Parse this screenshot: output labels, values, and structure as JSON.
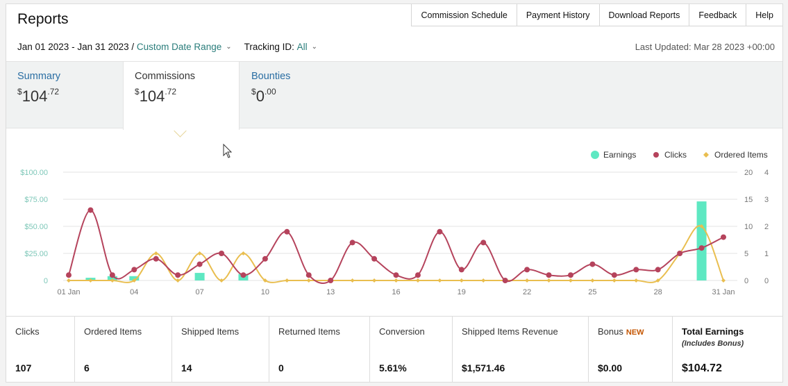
{
  "header": {
    "title": "Reports",
    "nav": [
      "Commission Schedule",
      "Payment History",
      "Download Reports",
      "Feedback",
      "Help"
    ]
  },
  "filters": {
    "date_range": "Jan 01 2023 - Jan 31 2023 /",
    "date_range_link": "Custom Date Range",
    "tracking_label": "Tracking ID:",
    "tracking_value": "All",
    "last_updated": "Last Updated: Mar 28 2023 +00:00"
  },
  "tabs": [
    {
      "label": "Summary",
      "dollar": "$",
      "whole": "104",
      "cents": ".72"
    },
    {
      "label": "Commissions",
      "dollar": "$",
      "whole": "104",
      "cents": ".72"
    },
    {
      "label": "Bounties",
      "dollar": "$",
      "whole": "0",
      "cents": ".00"
    }
  ],
  "legend": {
    "earnings": "Earnings",
    "clicks": "Clicks",
    "ordered": "Ordered Items"
  },
  "colors": {
    "earnings": "#5ee8c2",
    "clicks": "#b5435c",
    "ordered": "#e9be4f",
    "link": "#2a6ea3",
    "new_badge": "#c45500"
  },
  "chart_data": {
    "type": "bar+line",
    "categories": [
      "01 Jan",
      "02",
      "03",
      "04",
      "05",
      "06",
      "07",
      "08",
      "09",
      "10",
      "11",
      "12",
      "13",
      "14",
      "15",
      "16",
      "17",
      "18",
      "19",
      "20",
      "21",
      "22",
      "23",
      "24",
      "25",
      "26",
      "27",
      "28",
      "29",
      "30",
      "31 Jan"
    ],
    "x_tick_labels": [
      "01 Jan",
      "04",
      "07",
      "10",
      "13",
      "16",
      "19",
      "22",
      "25",
      "28",
      "31 Jan"
    ],
    "y_left_ticks": [
      "$100.00",
      "$75.00",
      "$50.00",
      "$25.00",
      "0"
    ],
    "y_left_range": [
      0,
      100
    ],
    "y_right1_ticks": [
      "20",
      "15",
      "10",
      "5",
      "0"
    ],
    "y_right1_range": [
      0,
      20
    ],
    "y_right2_ticks": [
      "4",
      "3",
      "2",
      "1",
      "0"
    ],
    "y_right2_range": [
      0,
      4
    ],
    "series": [
      {
        "name": "Earnings",
        "kind": "bar",
        "axis": "left",
        "values": [
          0,
          2.5,
          4,
          4,
          0,
          0,
          7,
          0,
          6,
          0,
          0,
          0,
          0,
          0,
          0,
          0,
          0,
          0,
          0,
          0,
          0,
          0,
          0,
          0,
          0,
          0,
          0,
          0,
          0,
          73,
          0
        ]
      },
      {
        "name": "Clicks",
        "kind": "line",
        "axis": "right1",
        "values": [
          1,
          13,
          1,
          2,
          4,
          1,
          3,
          5,
          1,
          4,
          9,
          1,
          0,
          7,
          4,
          1,
          1,
          9,
          2,
          7,
          0,
          2,
          1,
          1,
          3,
          1,
          2,
          2,
          5,
          6,
          8
        ]
      },
      {
        "name": "Ordered Items",
        "kind": "line",
        "axis": "right2",
        "values": [
          0,
          0,
          0,
          0,
          1,
          0,
          1,
          0,
          1,
          0,
          0,
          0,
          0,
          0,
          0,
          0,
          0,
          0,
          0,
          0,
          0,
          0,
          0,
          0,
          0,
          0,
          0,
          0,
          1,
          2,
          0
        ]
      }
    ],
    "grid": true,
    "legend_position": "top-right"
  },
  "stats": [
    {
      "label": "Clicks",
      "value": "107"
    },
    {
      "label": "Ordered Items",
      "value": "6"
    },
    {
      "label": "Shipped Items",
      "value": "14"
    },
    {
      "label": "Returned Items",
      "value": "0"
    },
    {
      "label": "Conversion",
      "value": "5.61%"
    },
    {
      "label": "Shipped Items Revenue",
      "value": "$1,571.46"
    },
    {
      "label": "Bonus",
      "badge": "NEW",
      "value": "$0.00"
    },
    {
      "label": "Total Earnings",
      "sub": "(Includes Bonus)",
      "value": "$104.72"
    }
  ]
}
